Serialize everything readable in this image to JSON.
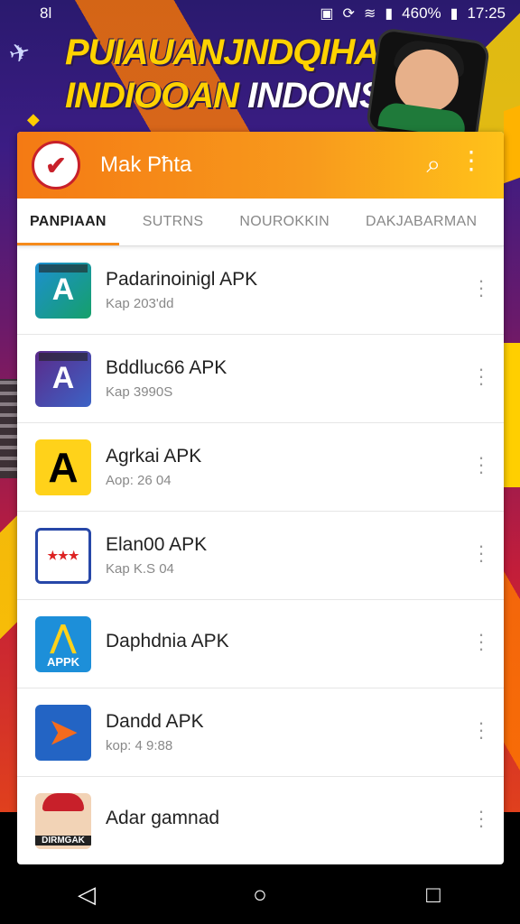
{
  "status_bar": {
    "left_text": "8l",
    "battery": "460%",
    "time": "17:25"
  },
  "banner": {
    "line1": "PUIAUANJNDQIHAN",
    "line2_prefix": "INDIOOAN ",
    "line2_highlight": "INDONSIA!"
  },
  "app_bar": {
    "title": "Mak Pħta",
    "search_icon": "search-icon",
    "more_icon": "more-vertical-icon"
  },
  "tabs": [
    {
      "label": "PANPIAAN",
      "active": true
    },
    {
      "label": "SUTRNS",
      "active": false
    },
    {
      "label": "NOUROKKIN",
      "active": false
    },
    {
      "label": "DAKJABARMAN",
      "active": false
    }
  ],
  "apps": [
    {
      "name": "Padarinoinigl APK",
      "sub": "Kap 203'dd",
      "icon": "app-icon-blue-green"
    },
    {
      "name": "Bddluc66 APK",
      "sub": "Kap 3990S",
      "icon": "app-icon-purple-blue"
    },
    {
      "name": "Agrkai APK",
      "sub": "Aop: 26 04",
      "icon": "app-icon-yellow-a"
    },
    {
      "name": "Elan00 APK",
      "sub": "Kap K.S 04",
      "icon": "app-icon-badge"
    },
    {
      "name": "Daphdnia APK",
      "sub": "",
      "icon": "app-icon-appk",
      "icon_text": "APPK"
    },
    {
      "name": "Dandd APK",
      "sub": "kop: 4 9:88",
      "icon": "app-icon-arrow"
    },
    {
      "name": "Adar gamnad",
      "sub": "",
      "icon": "app-icon-avatar",
      "icon_text": "DIRMGAK"
    }
  ],
  "nav_bar": {
    "back_icon": "back-triangle-icon",
    "home_icon": "home-circle-icon",
    "recents_icon": "recents-square-icon"
  }
}
